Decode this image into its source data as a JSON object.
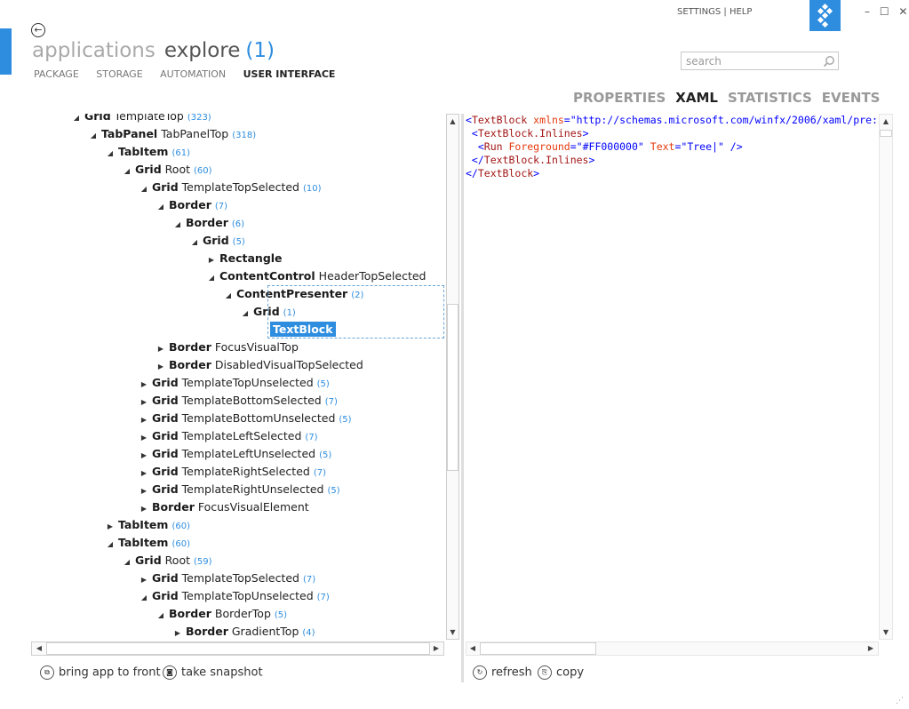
{
  "header": {
    "title_app": "applications",
    "title_section": "explore",
    "title_count": "(1)",
    "nav": [
      "PACKAGE",
      "STORAGE",
      "AUTOMATION",
      "USER INTERFACE"
    ],
    "nav_active": "USER INTERFACE",
    "top_links": "SETTINGS | HELP",
    "window_controls": [
      "–",
      "☐",
      "✕"
    ]
  },
  "search": {
    "placeholder": "search"
  },
  "detail_tabs": [
    "PROPERTIES",
    "XAML",
    "STATISTICS",
    "EVENTS"
  ],
  "detail_tab_active": "XAML",
  "tree": {
    "rows": [
      {
        "d": 4,
        "exp": "open",
        "name": "Grid",
        "extra": "TemplateTop",
        "count": "(323)"
      },
      {
        "d": 5,
        "exp": "open",
        "name": "TabPanel",
        "extra": "TabPanelTop",
        "count": "(318)"
      },
      {
        "d": 6,
        "exp": "open",
        "name": "TabItem",
        "extra": "",
        "count": "(61)"
      },
      {
        "d": 7,
        "exp": "open",
        "name": "Grid",
        "extra": "Root",
        "count": "(60)"
      },
      {
        "d": 8,
        "exp": "open",
        "name": "Grid",
        "extra": "TemplateTopSelected",
        "count": "(10)"
      },
      {
        "d": 9,
        "exp": "open",
        "name": "Border",
        "extra": "",
        "count": "(7)"
      },
      {
        "d": 10,
        "exp": "open",
        "name": "Border",
        "extra": "",
        "count": "(6)"
      },
      {
        "d": 11,
        "exp": "open",
        "name": "Grid",
        "extra": "",
        "count": "(5)"
      },
      {
        "d": 12,
        "exp": "closed",
        "name": "Rectangle",
        "extra": "",
        "count": ""
      },
      {
        "d": 12,
        "exp": "open",
        "name": "ContentControl",
        "extra": "HeaderTopSelected",
        "count": ""
      },
      {
        "d": 13,
        "exp": "open",
        "name": "ContentPresenter",
        "extra": "",
        "count": "(2)"
      },
      {
        "d": 14,
        "exp": "open",
        "name": "Grid",
        "extra": "",
        "count": "(1)"
      },
      {
        "d": 15,
        "exp": "none",
        "name": "TextBlock",
        "extra": "",
        "count": "",
        "selected": true
      },
      {
        "d": 9,
        "exp": "closed",
        "name": "Border",
        "extra": "FocusVisualTop",
        "count": ""
      },
      {
        "d": 9,
        "exp": "closed",
        "name": "Border",
        "extra": "DisabledVisualTopSelected",
        "count": ""
      },
      {
        "d": 8,
        "exp": "closed",
        "name": "Grid",
        "extra": "TemplateTopUnselected",
        "count": "(5)"
      },
      {
        "d": 8,
        "exp": "closed",
        "name": "Grid",
        "extra": "TemplateBottomSelected",
        "count": "(7)"
      },
      {
        "d": 8,
        "exp": "closed",
        "name": "Grid",
        "extra": "TemplateBottomUnselected",
        "count": "(5)"
      },
      {
        "d": 8,
        "exp": "closed",
        "name": "Grid",
        "extra": "TemplateLeftSelected",
        "count": "(7)"
      },
      {
        "d": 8,
        "exp": "closed",
        "name": "Grid",
        "extra": "TemplateLeftUnselected",
        "count": "(5)"
      },
      {
        "d": 8,
        "exp": "closed",
        "name": "Grid",
        "extra": "TemplateRightSelected",
        "count": "(7)"
      },
      {
        "d": 8,
        "exp": "closed",
        "name": "Grid",
        "extra": "TemplateRightUnselected",
        "count": "(5)"
      },
      {
        "d": 8,
        "exp": "closed",
        "name": "Border",
        "extra": "FocusVisualElement",
        "count": ""
      },
      {
        "d": 6,
        "exp": "closed",
        "name": "TabItem",
        "extra": "",
        "count": "(60)"
      },
      {
        "d": 6,
        "exp": "open",
        "name": "TabItem",
        "extra": "",
        "count": "(60)"
      },
      {
        "d": 7,
        "exp": "open",
        "name": "Grid",
        "extra": "Root",
        "count": "(59)"
      },
      {
        "d": 8,
        "exp": "closed",
        "name": "Grid",
        "extra": "TemplateTopSelected",
        "count": "(7)"
      },
      {
        "d": 8,
        "exp": "open",
        "name": "Grid",
        "extra": "TemplateTopUnselected",
        "count": "(7)"
      },
      {
        "d": 9,
        "exp": "open",
        "name": "Border",
        "extra": "BorderTop",
        "count": "(5)"
      },
      {
        "d": 10,
        "exp": "closed",
        "name": "Border",
        "extra": "GradientTop",
        "count": "(4)"
      }
    ]
  },
  "xaml": {
    "lines": [
      [
        {
          "t": "<",
          "c": "pun"
        },
        {
          "t": "TextBlock",
          "c": "tag"
        },
        {
          "t": " xmlns",
          "c": "att"
        },
        {
          "t": "=",
          "c": "pun"
        },
        {
          "t": "\"http://schemas.microsoft.com/winfx/2006/xaml/pre:",
          "c": "val"
        }
      ],
      [
        {
          "t": " <",
          "c": "pun"
        },
        {
          "t": "TextBlock.Inlines",
          "c": "tag"
        },
        {
          "t": ">",
          "c": "pun"
        }
      ],
      [
        {
          "t": "  <",
          "c": "pun"
        },
        {
          "t": "Run",
          "c": "tag"
        },
        {
          "t": " Foreground",
          "c": "att"
        },
        {
          "t": "=",
          "c": "pun"
        },
        {
          "t": "\"#FF000000\"",
          "c": "val"
        },
        {
          "t": " Text",
          "c": "att"
        },
        {
          "t": "=",
          "c": "pun"
        },
        {
          "t": "\"Tree|\"",
          "c": "val"
        },
        {
          "t": " />",
          "c": "pun"
        }
      ],
      [
        {
          "t": " </",
          "c": "pun"
        },
        {
          "t": "TextBlock.Inlines",
          "c": "tag"
        },
        {
          "t": ">",
          "c": "pun"
        }
      ],
      [
        {
          "t": "</",
          "c": "pun"
        },
        {
          "t": "TextBlock",
          "c": "tag"
        },
        {
          "t": ">",
          "c": "pun"
        }
      ]
    ]
  },
  "bottom": {
    "bring_to_front": "bring app to front",
    "take_snapshot": "take snapshot",
    "refresh": "refresh",
    "copy": "copy"
  },
  "colors": {
    "accent": "#2e8ddf"
  }
}
